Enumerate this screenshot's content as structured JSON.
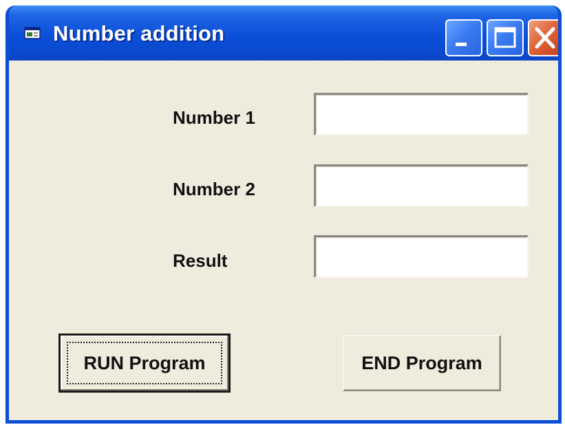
{
  "window": {
    "title": "Number addition",
    "icon": "vb-form-icon",
    "caption_buttons": [
      "minimize-icon",
      "maximize-icon",
      "close-icon"
    ]
  },
  "form": {
    "number1": {
      "label": "Number 1",
      "value": ""
    },
    "number2": {
      "label": "Number 2",
      "value": ""
    },
    "result": {
      "label": "Result",
      "value": ""
    }
  },
  "buttons": {
    "run_label": "RUN Program",
    "end_label": "END Program"
  },
  "colors": {
    "titlebar": "#0a4fd6",
    "client_background": "#efebdd",
    "close_button": "#e0653a"
  }
}
